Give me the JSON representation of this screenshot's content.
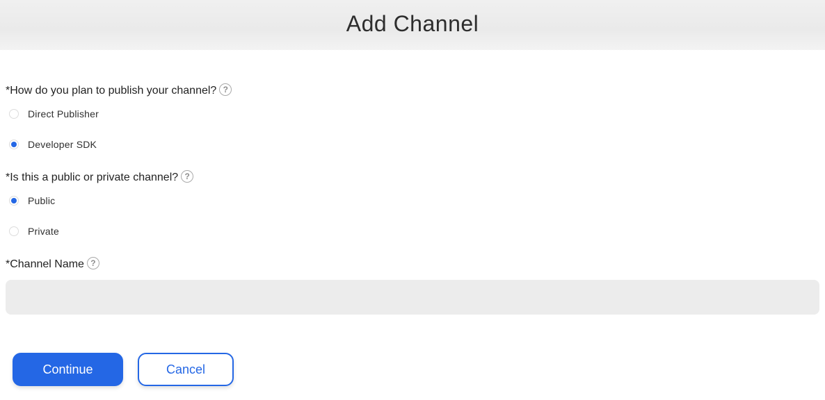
{
  "header": {
    "title": "Add Channel"
  },
  "colors": {
    "accent": "#2467e5",
    "input_bg": "#ececec",
    "header_bg": "#eeeeee"
  },
  "form": {
    "publish_question": {
      "label": "*How do you plan to publish your channel?",
      "help_icon": "?",
      "options": [
        {
          "label": "Direct Publisher",
          "selected": false
        },
        {
          "label": "Developer SDK",
          "selected": true
        }
      ]
    },
    "visibility_question": {
      "label": "*Is this a public or private channel?",
      "help_icon": "?",
      "options": [
        {
          "label": "Public",
          "selected": true
        },
        {
          "label": "Private",
          "selected": false
        }
      ]
    },
    "channel_name": {
      "label": "*Channel Name",
      "help_icon": "?",
      "value": "",
      "placeholder": ""
    }
  },
  "actions": {
    "continue_label": "Continue",
    "cancel_label": "Cancel"
  }
}
